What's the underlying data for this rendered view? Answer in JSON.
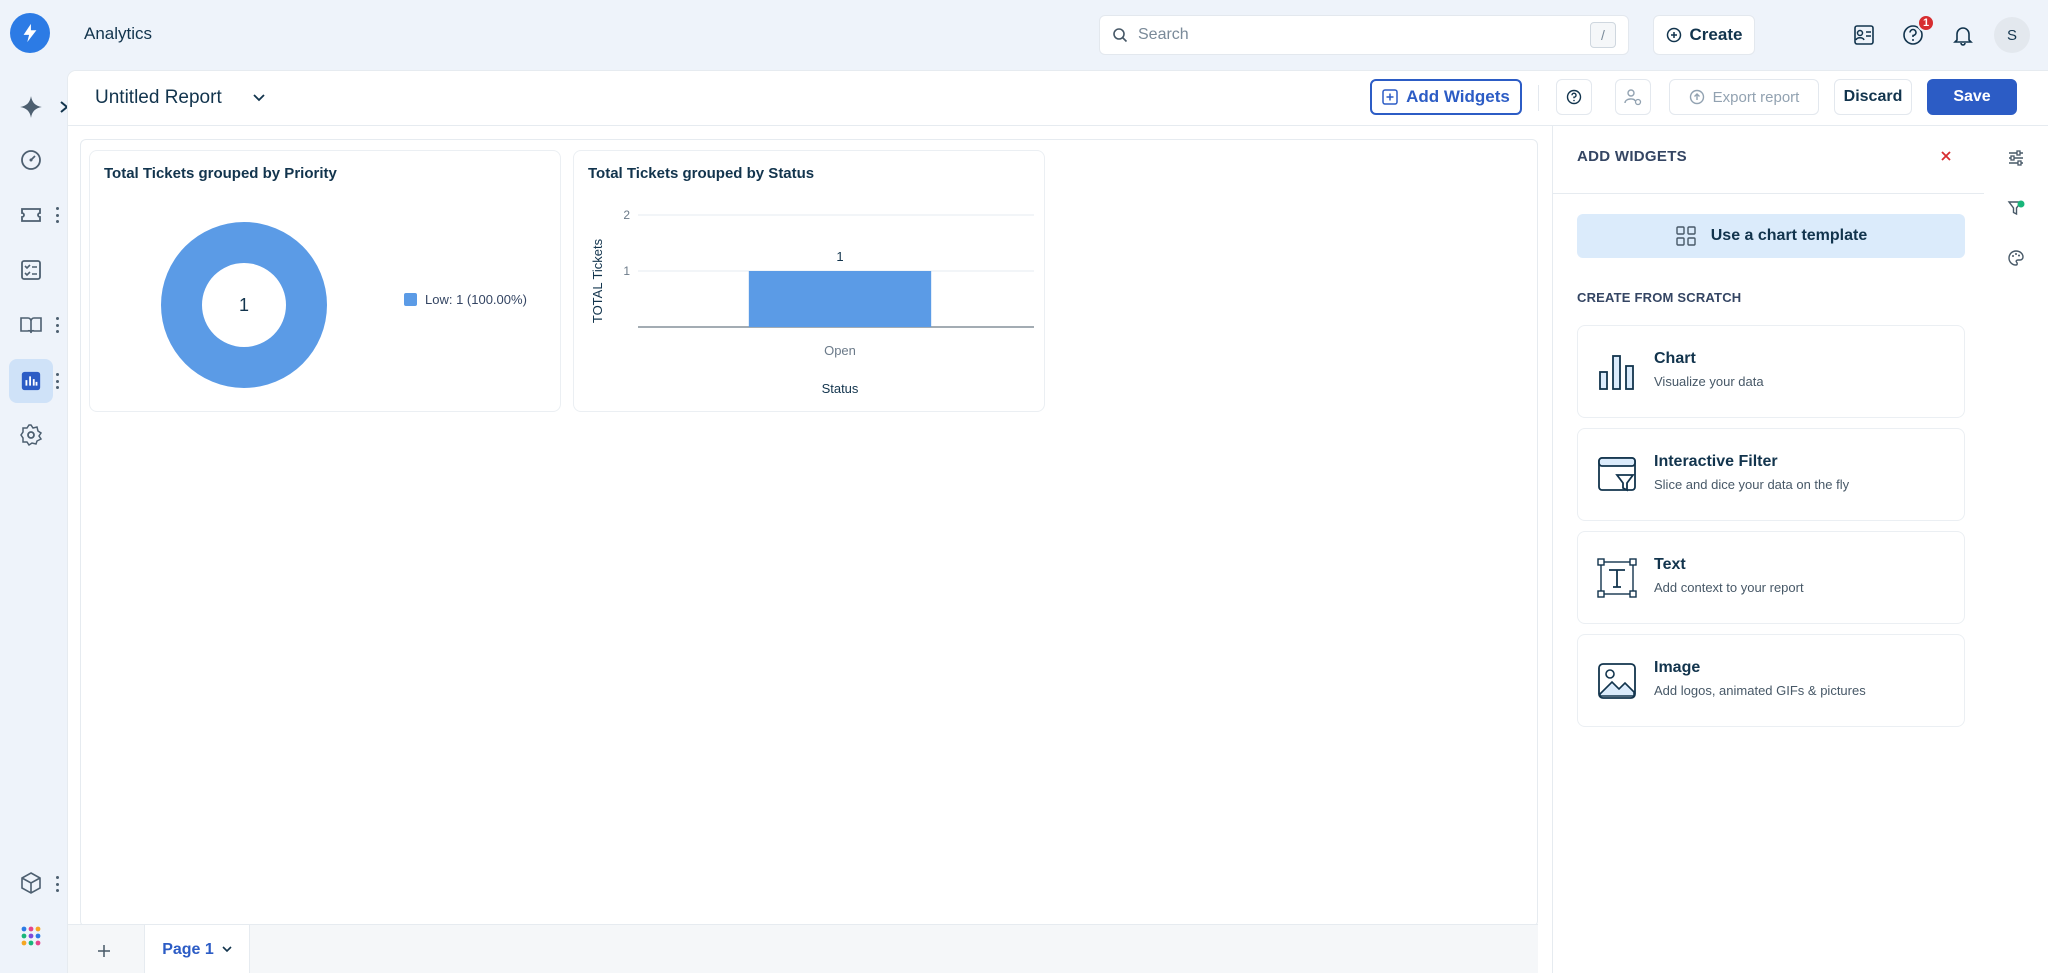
{
  "app": {
    "title": "Analytics"
  },
  "search": {
    "placeholder": "Search",
    "shortcut": "/"
  },
  "topbar": {
    "create_label": "Create",
    "help_badge": "1",
    "avatar_initial": "S"
  },
  "report": {
    "title": "Untitled Report",
    "add_widgets_label": "Add Widgets",
    "export_label": "Export report",
    "discard_label": "Discard",
    "save_label": "Save"
  },
  "widgets": [
    {
      "title": "Total Tickets grouped by Priority",
      "center_value": "1",
      "legend": "Low: 1 (100.00%)"
    },
    {
      "title": "Total Tickets grouped by Status"
    }
  ],
  "chart_data": [
    {
      "type": "pie",
      "title": "Total Tickets grouped by Priority",
      "categories": [
        "Low"
      ],
      "values": [
        1
      ],
      "legend_position": "right",
      "center_label": "1"
    },
    {
      "type": "bar",
      "title": "Total Tickets grouped by Status",
      "categories": [
        "Open"
      ],
      "values": [
        1
      ],
      "data_labels": [
        "1"
      ],
      "ylim": [
        0,
        2
      ],
      "yticks": [
        "1",
        "2"
      ],
      "xlabel": "Status",
      "ylabel": "TOTAL Tickets",
      "grid": true
    }
  ],
  "panel": {
    "title": "ADD WIDGETS",
    "template_label": "Use a chart template",
    "scratch_heading": "CREATE FROM SCRATCH",
    "cards": [
      {
        "title": "Chart",
        "desc": "Visualize your data",
        "icon": "bar-chart-icon"
      },
      {
        "title": "Interactive Filter",
        "desc": "Slice and dice your data on the fly",
        "icon": "filter-window-icon"
      },
      {
        "title": "Text",
        "desc": "Add context to your report",
        "icon": "text-box-icon"
      },
      {
        "title": "Image",
        "desc": "Add logos, animated GIFs & pictures",
        "icon": "image-icon"
      }
    ]
  },
  "footer": {
    "page_tab": "Page 1"
  },
  "colors": {
    "accent": "#2c5cc5",
    "series": "#5b9be6",
    "nav_active": "#cfe2f8",
    "badge": "#d72d30"
  }
}
